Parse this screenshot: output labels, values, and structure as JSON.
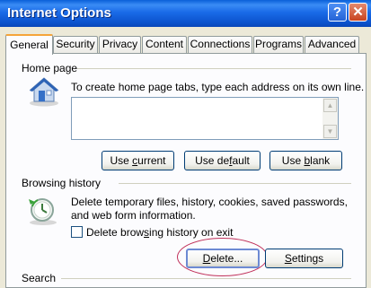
{
  "window": {
    "title": "Internet Options",
    "help_label": "?",
    "close_label": "✕"
  },
  "tabs": [
    {
      "label": "General",
      "active": true
    },
    {
      "label": "Security"
    },
    {
      "label": "Privacy"
    },
    {
      "label": "Content"
    },
    {
      "label": "Connections"
    },
    {
      "label": "Programs"
    },
    {
      "label": "Advanced"
    }
  ],
  "home_page": {
    "group_label": "Home page",
    "description": "To create home page tabs, type each address on its own line.",
    "address_value": "",
    "buttons": {
      "use_current_pre": "Use ",
      "use_current_key": "c",
      "use_current_post": "urrent",
      "use_default_pre": "Use de",
      "use_default_key": "f",
      "use_default_post": "ault",
      "use_blank_pre": "Use ",
      "use_blank_key": "b",
      "use_blank_post": "lank"
    },
    "icon": "house-icon"
  },
  "browsing_history": {
    "group_label": "Browsing history",
    "description_line1": "Delete temporary files, history, cookies, saved passwords,",
    "description_line2": "and web form information.",
    "checkbox_pre": "Delete brow",
    "checkbox_key": "s",
    "checkbox_post": "ing history on exit",
    "checkbox_checked": false,
    "delete_pre": "",
    "delete_key": "D",
    "delete_post": "elete...",
    "settings_pre": "",
    "settings_key": "S",
    "settings_post": "ettings",
    "icon": "history-clock-icon",
    "highlight_color": "#c0305a"
  },
  "search": {
    "group_label": "Search"
  },
  "colors": {
    "titlebar": "#0b52cc",
    "dialog_bg": "#ece9d8",
    "active_tab_accent": "#f5a43a"
  }
}
